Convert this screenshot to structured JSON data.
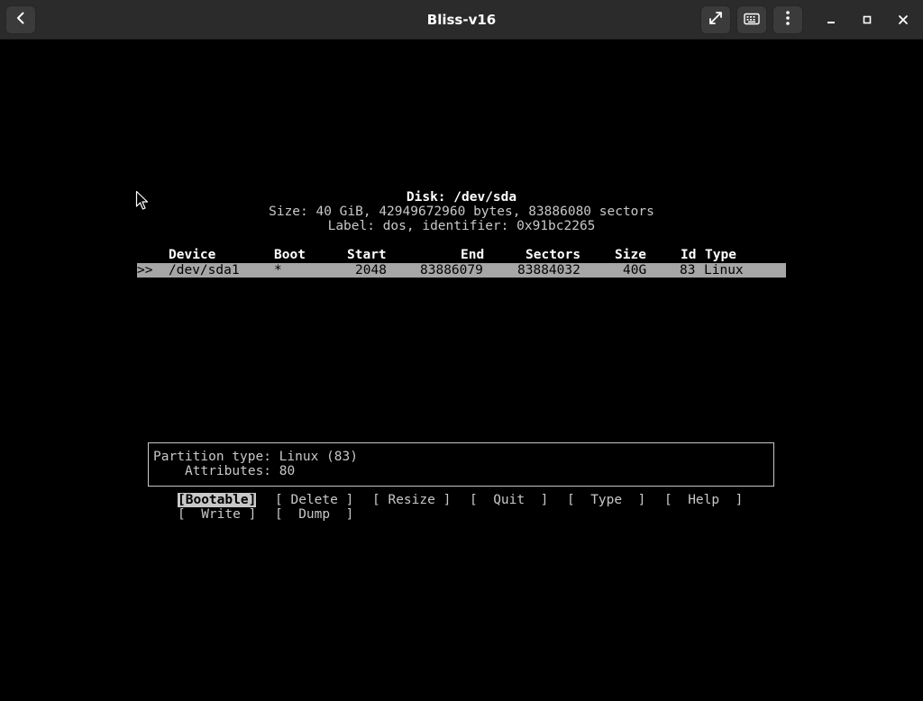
{
  "window": {
    "title": "Bliss-v16",
    "icons": {
      "back": "back-arrow-icon",
      "fullscreen": "fullscreen-icon",
      "keyboard": "keyboard-icon",
      "menu": "vertical-dots-icon",
      "minimize": "minimize-icon",
      "maximize": "maximize-icon",
      "close": "close-icon"
    }
  },
  "terminal": {
    "disk_line": "Disk: /dev/sda",
    "size_line": "Size: 40 GiB, 42949672960 bytes, 83886080 sectors",
    "label_line": "Label: dos, identifier: 0x91bc2265",
    "table": {
      "headers": {
        "device": "Device",
        "boot": "Boot",
        "start": "Start",
        "end": "End",
        "sectors": "Sectors",
        "size": "Size",
        "id": "Id",
        "type": "Type"
      },
      "rows": [
        {
          "marker": ">>",
          "device": "/dev/sda1",
          "boot": "*",
          "start": "2048",
          "end": "83886079",
          "sectors": "83884032",
          "size": "40G",
          "id": "83",
          "type": "Linux",
          "selected": true
        }
      ]
    },
    "info": {
      "partition_type": "Partition type: Linux (83)",
      "attributes": "Attributes: 80"
    },
    "menu": {
      "bootable": "[Bootable]",
      "delete": "[ Delete ]",
      "resize": "[ Resize ]",
      "quit": "[  Quit  ]",
      "type": "[  Type  ]",
      "help": "[  Help  ]",
      "write": "[  Write ]",
      "dump": "[  Dump  ]",
      "selected": "bootable"
    }
  },
  "colors": {
    "background": "#000000",
    "text": "#c8c8c8",
    "highlight_bg": "#a6a6a6",
    "titlebar": "#2b2b2b"
  }
}
